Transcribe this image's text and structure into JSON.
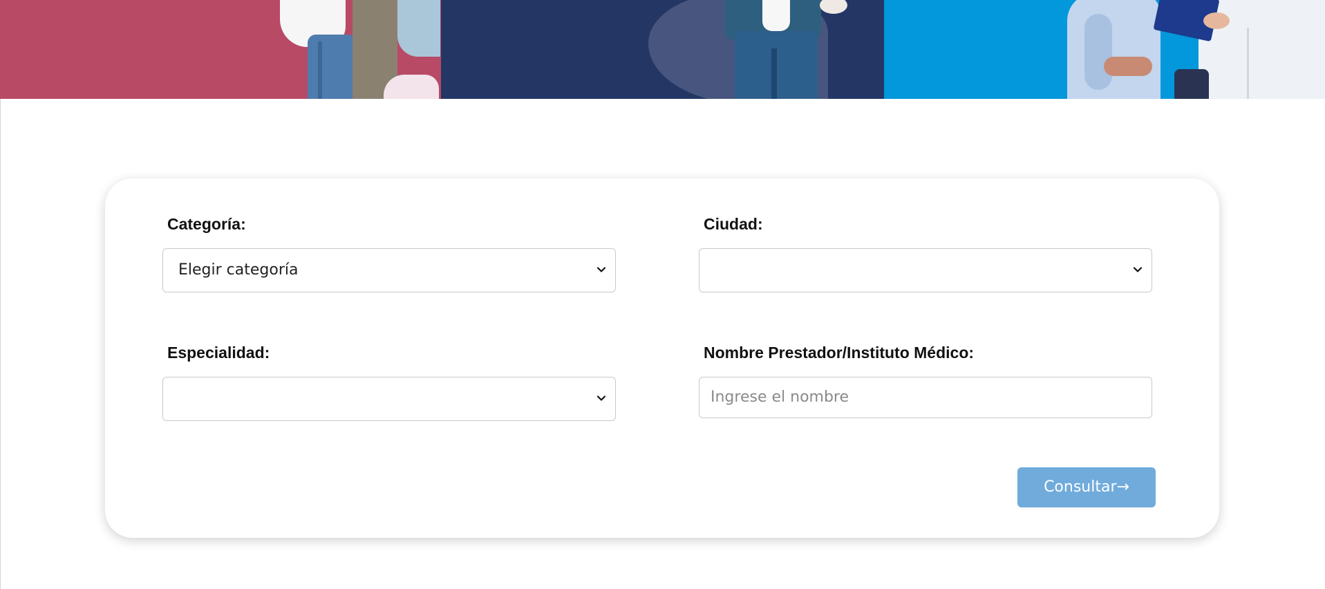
{
  "banner": {
    "panels": [
      {
        "color": "#b84a66"
      },
      {
        "color": "#243664"
      },
      {
        "color": "#0397dc"
      }
    ]
  },
  "form": {
    "categoria": {
      "label": "Categoría:",
      "selected": "Elegir categoría"
    },
    "ciudad": {
      "label": "Ciudad:",
      "selected": ""
    },
    "especialidad": {
      "label": "Especialidad:",
      "selected": ""
    },
    "nombre": {
      "label": "Nombre Prestador/Instituto Médico:",
      "placeholder": "Ingrese el nombre"
    },
    "submit_label": "Consultar→",
    "submit_color": "#70abdc"
  }
}
